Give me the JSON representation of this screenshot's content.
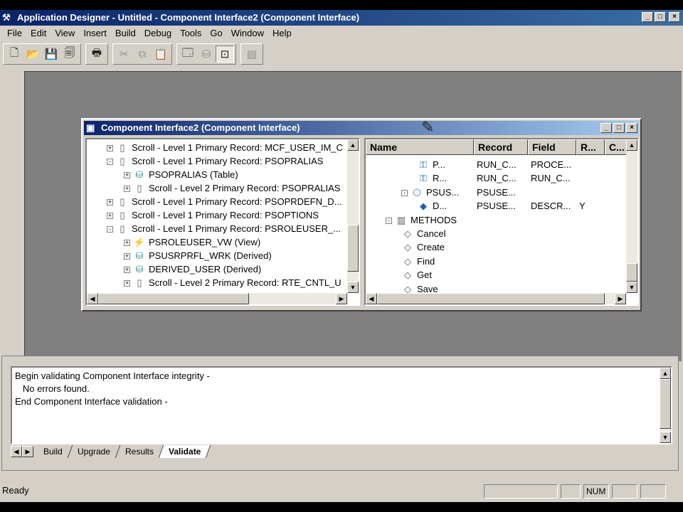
{
  "app": {
    "title": "Application Designer - Untitled - Component Interface2 (Component Interface)",
    "menu": [
      "File",
      "Edit",
      "View",
      "Insert",
      "Build",
      "Debug",
      "Tools",
      "Go",
      "Window",
      "Help"
    ]
  },
  "child_window": {
    "title": "Component Interface2 (Component Interface)",
    "left_tree": [
      {
        "text": "Scroll - Level 1  Primary Record: MCF_USER_IM_C",
        "icon": "scroll-icon",
        "indent": 0,
        "exp": "+"
      },
      {
        "text": "Scroll - Level 1  Primary Record: PSOPRALIAS",
        "icon": "scroll-icon",
        "indent": 0,
        "exp": "-"
      },
      {
        "text": "PSOPRALIAS (Table)",
        "icon": "database-icon",
        "indent": 1,
        "exp": "+"
      },
      {
        "text": "Scroll - Level 2  Primary Record: PSOPRALIAS",
        "icon": "scroll-icon",
        "indent": 1,
        "exp": "+"
      },
      {
        "text": "Scroll - Level 1  Primary Record: PSOPRDEFN_D...",
        "icon": "scroll-icon",
        "indent": 0,
        "exp": "+"
      },
      {
        "text": "Scroll - Level 1  Primary Record: PSOPTIONS",
        "icon": "scroll-icon",
        "indent": 0,
        "exp": "+"
      },
      {
        "text": "Scroll - Level 1  Primary Record: PSROLEUSER_...",
        "icon": "scroll-icon",
        "indent": 0,
        "exp": "-"
      },
      {
        "text": "PSROLEUSER_VW (View)",
        "icon": "view-icon",
        "indent": 1,
        "exp": "+"
      },
      {
        "text": "PSUSRPRFL_WRK (Derived)",
        "icon": "database-icon",
        "indent": 1,
        "exp": "+"
      },
      {
        "text": "DERIVED_USER (Derived)",
        "icon": "database-icon",
        "indent": 1,
        "exp": "+"
      },
      {
        "text": "Scroll - Level 2  Primary Record: RTE_CNTL_U",
        "icon": "scroll-icon",
        "indent": 1,
        "exp": "+"
      }
    ],
    "grid_headers": [
      "Name",
      "Record",
      "Field",
      "R...",
      "C..."
    ],
    "grid_rows": [
      {
        "name": "P...",
        "record": "RUN_C...",
        "field": "PROCE...",
        "r": "",
        "icon": "property-icon",
        "indent": 3,
        "exp": ""
      },
      {
        "name": "R...",
        "record": "RUN_C...",
        "field": "RUN_C...",
        "r": "",
        "icon": "property-icon",
        "indent": 3,
        "exp": ""
      },
      {
        "name": "PSUS...",
        "record": "PSUSE...",
        "field": "",
        "r": "",
        "icon": "collection-icon",
        "indent": 2,
        "exp": "-"
      },
      {
        "name": "D...",
        "record": "PSUSE...",
        "field": "DESCR...",
        "r": "Y",
        "icon": "key-icon",
        "indent": 3,
        "exp": ""
      },
      {
        "name": "METHODS",
        "record": "",
        "field": "",
        "r": "",
        "icon": "book-icon",
        "indent": 1,
        "exp": "-"
      },
      {
        "name": "Cancel",
        "record": "",
        "field": "",
        "r": "",
        "icon": "method-icon",
        "indent": 2,
        "exp": ""
      },
      {
        "name": "Create",
        "record": "",
        "field": "",
        "r": "",
        "icon": "method-icon",
        "indent": 2,
        "exp": ""
      },
      {
        "name": "Find",
        "record": "",
        "field": "",
        "r": "",
        "icon": "method-icon",
        "indent": 2,
        "exp": ""
      },
      {
        "name": "Get",
        "record": "",
        "field": "",
        "r": "",
        "icon": "method-icon",
        "indent": 2,
        "exp": ""
      },
      {
        "name": "Save",
        "record": "",
        "field": "",
        "r": "",
        "icon": "method-icon",
        "indent": 2,
        "exp": ""
      }
    ]
  },
  "output": {
    "lines": [
      "Begin validating Component Interface integrity -",
      "   No errors found.",
      "End Component Interface validation -"
    ],
    "tabs": [
      "Build",
      "Upgrade",
      "Results",
      "Validate"
    ],
    "active_tab": "Validate"
  },
  "status": {
    "text": "Ready",
    "num": "NUM"
  }
}
